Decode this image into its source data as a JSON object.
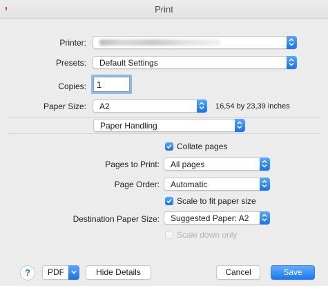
{
  "window": {
    "title": "Print"
  },
  "printer": {
    "label": "Printer:",
    "value": ""
  },
  "presets": {
    "label": "Presets:",
    "value": "Default Settings"
  },
  "copies": {
    "label": "Copies:",
    "value": "1"
  },
  "paper_size": {
    "label": "Paper Size:",
    "value": "A2",
    "dimensions": "16,54 by 23,39 inches"
  },
  "section": {
    "value": "Paper Handling"
  },
  "collate": {
    "label": "Collate pages",
    "checked": true
  },
  "pages_to_print": {
    "label": "Pages to Print:",
    "value": "All pages"
  },
  "page_order": {
    "label": "Page Order:",
    "value": "Automatic"
  },
  "scale_to_fit": {
    "label": "Scale to fit paper size",
    "checked": true
  },
  "destination_paper_size": {
    "label": "Destination Paper Size:",
    "value": "Suggested Paper: A2"
  },
  "scale_down": {
    "label": "Scale down only",
    "checked": false,
    "enabled": false
  },
  "footer": {
    "help": "?",
    "pdf": "PDF",
    "hide_details": "Hide Details",
    "cancel": "Cancel",
    "save": "Save"
  },
  "colors": {
    "accent": "#1a73e8",
    "background": "#ececec"
  },
  "icons": {
    "stepper": "up-down-arrows-icon",
    "check": "checkmark-icon",
    "chevron": "chevron-down-icon",
    "help": "question-mark-icon"
  }
}
